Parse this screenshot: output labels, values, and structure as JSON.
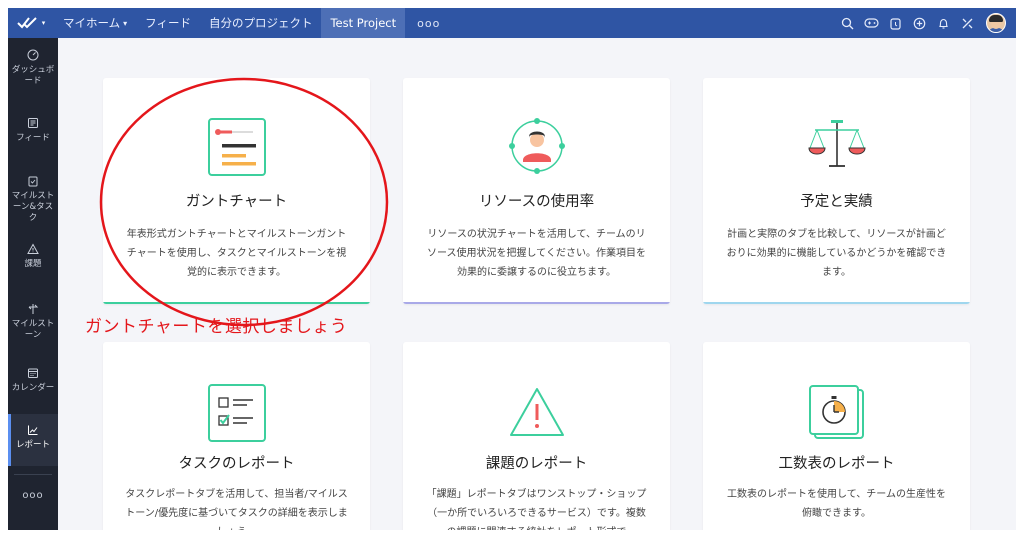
{
  "topbar": {
    "nav": [
      {
        "label": "マイホーム",
        "caret": "▾"
      },
      {
        "label": "フィード"
      },
      {
        "label": "自分のプロジェクト"
      },
      {
        "label": "Test Project"
      }
    ],
    "more": "ooo"
  },
  "sidebar": {
    "items": [
      {
        "label": "ダッシュボード"
      },
      {
        "label": "フィード"
      },
      {
        "label": "マイルストーン&タスク"
      },
      {
        "label": "課題"
      },
      {
        "label": "マイルストーン"
      },
      {
        "label": "カレンダー"
      },
      {
        "label": "レポート"
      }
    ],
    "more": "ooo"
  },
  "cards": [
    {
      "title": "ガントチャート",
      "desc": "年表形式ガントチャートとマイルストーンガントチャートを使用し、タスクとマイルストーンを視覚的に表示できます。",
      "accent": "#3ccf9d"
    },
    {
      "title": "リソースの使用率",
      "desc": "リソースの状況チャートを活用して、チームのリソース使用状況を把握してください。作業項目を効果的に委譲するのに役立ちます。",
      "accent": "#a9a9e8"
    },
    {
      "title": "予定と実績",
      "desc": "計画と実際のタブを比較して、リソースが計画どおりに効果的に機能しているかどうかを確認できます。",
      "accent": "#9fd6ee"
    },
    {
      "title": "タスクのレポート",
      "desc": "タスクレポートタブを活用して、担当者/マイルストーン/優先度に基づいてタスクの詳細を表示しましょう。"
    },
    {
      "title": "課題のレポート",
      "desc": "「課題」レポートタブはワンストップ・ショップ（一か所でいろいろできるサービス）です。複数の課題に関連する統計をレポート形式で"
    },
    {
      "title": "工数表のレポート",
      "desc": "工数表のレポートを使用して、チームの生産性を俯瞰できます。"
    }
  ],
  "annotation": {
    "text": "ガントチャートを選択しましょう",
    "color": "#e4161b"
  },
  "colors": {
    "topbar": "#2f55a4",
    "sidebar": "#1f2430",
    "icon_green": "#3ccf9d",
    "icon_red": "#ef5b5b",
    "icon_orange": "#f6b04a"
  }
}
